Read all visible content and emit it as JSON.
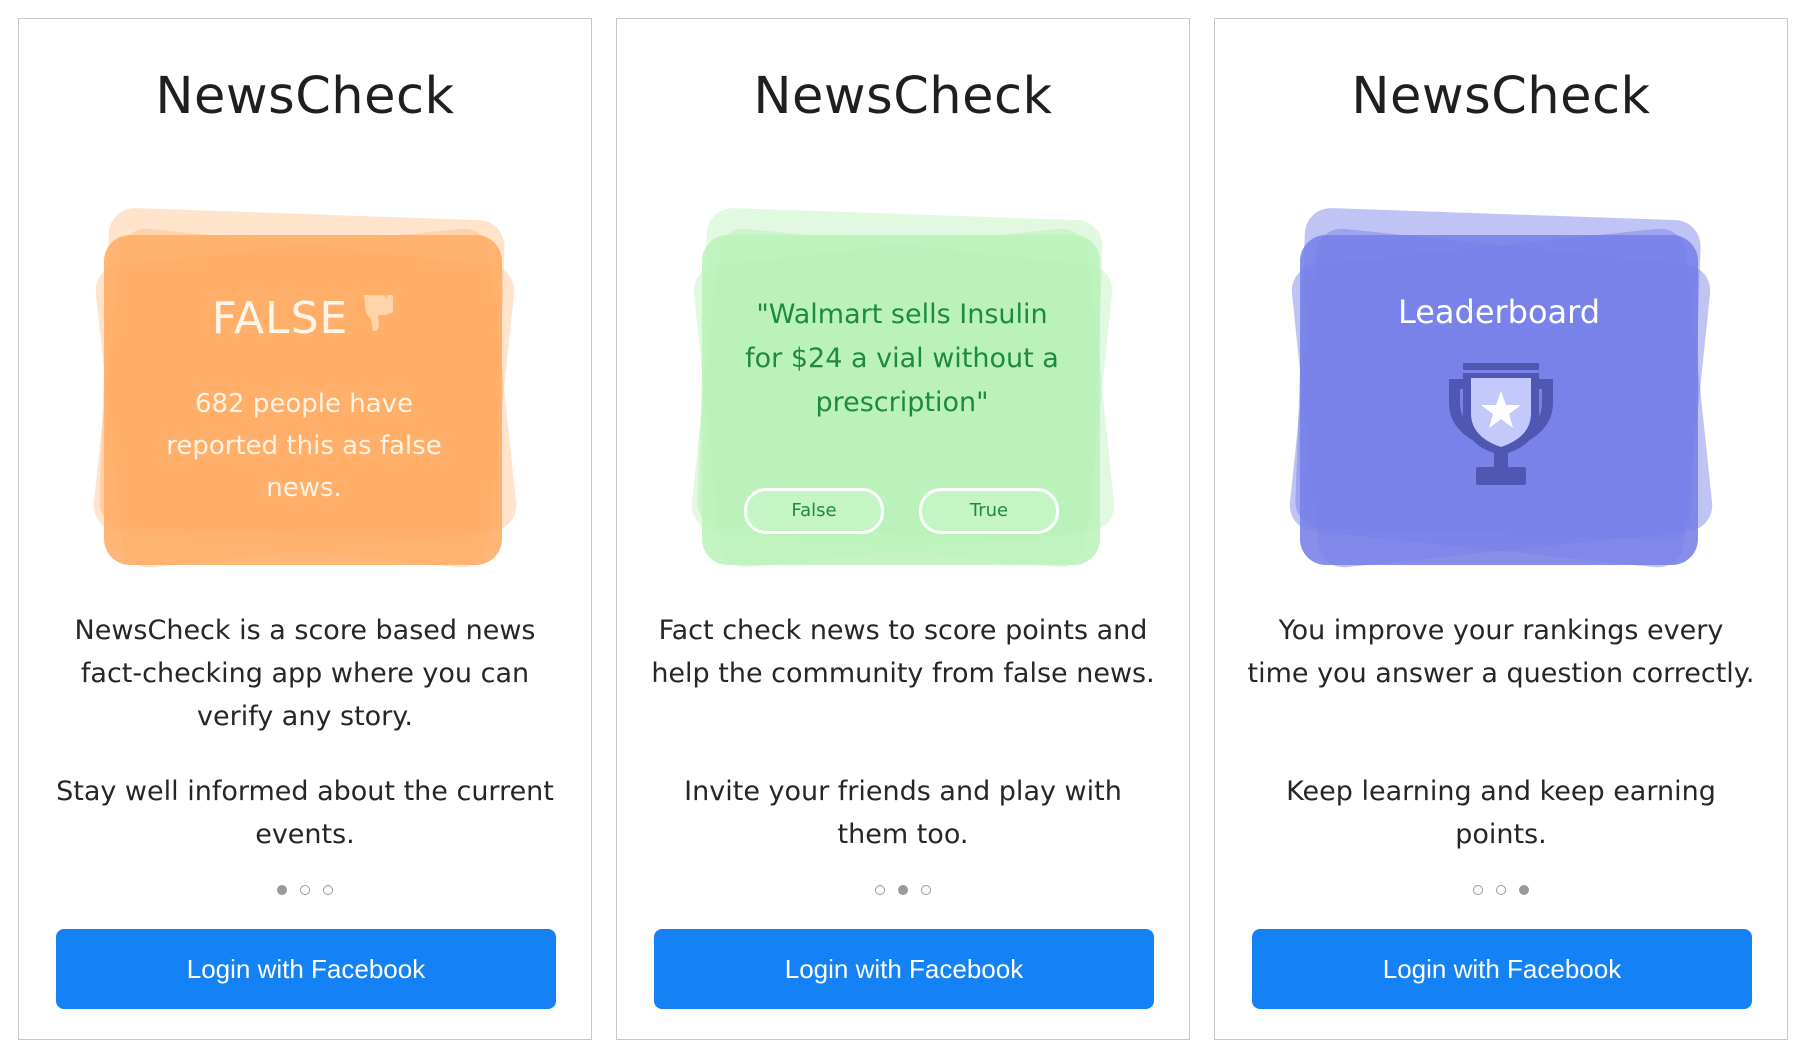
{
  "app_title": "NewsCheck",
  "login_button_label": "Login with Facebook",
  "colors": {
    "orange_card": "#FFAC64",
    "green_card": "#BAF2BA",
    "purple_card": "#7680E8",
    "button": "#1482F5",
    "green_text": "#1E8A3E"
  },
  "screens": [
    {
      "card": {
        "heading": "FALSE",
        "icon": "thumbs-down-icon",
        "subtext": "682 people have reported this as false news."
      },
      "description": "NewsCheck is a score based news fact-checking app where you can verify any story.",
      "tagline": "Stay well informed about the current events.",
      "active_page": 1,
      "page_count": 3
    },
    {
      "card": {
        "quote": "\"Walmart sells Insulin for $24 a vial without a prescription\"",
        "options": [
          "False",
          "True"
        ]
      },
      "description": "Fact check news to score points and help the community from false news.",
      "tagline": "Invite your friends and play with them too.",
      "active_page": 2,
      "page_count": 3
    },
    {
      "card": {
        "heading": "Leaderboard",
        "icon": "trophy-icon"
      },
      "description": "You improve your rankings every time you answer a question correctly.",
      "tagline": "Keep learning and keep earning points.",
      "active_page": 3,
      "page_count": 3
    }
  ]
}
